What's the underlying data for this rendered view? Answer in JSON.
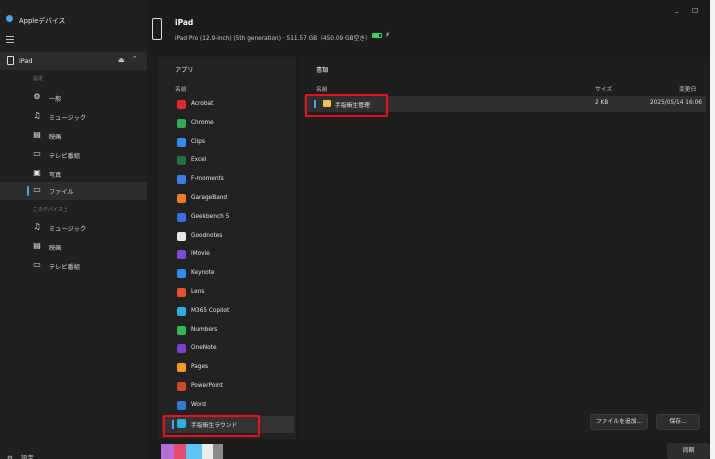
{
  "app": {
    "title": "Appleデバイス"
  },
  "sidebar": {
    "device_label": "iPad",
    "section_settings": "設定",
    "section_on_device": "このデバイス上",
    "items": [
      {
        "label": "一般",
        "icon": "gear-icon"
      },
      {
        "label": "ミュージック",
        "icon": "music-note-icon"
      },
      {
        "label": "映画",
        "icon": "film-icon"
      },
      {
        "label": "テレビ番組",
        "icon": "tv-icon"
      },
      {
        "label": "写真",
        "icon": "photo-icon"
      },
      {
        "label": "ファイル",
        "icon": "folder-icon"
      }
    ],
    "device_items": [
      {
        "label": "ミュージック",
        "icon": "music-note-icon"
      },
      {
        "label": "映画",
        "icon": "film-icon"
      },
      {
        "label": "テレビ番組",
        "icon": "tv-icon"
      }
    ],
    "settings_label": "設定"
  },
  "header": {
    "device_name": "iPad",
    "device_info": "iPad Pro (12.9-inch) (5th generation) · 511.57 GB（450.09 GB空き）"
  },
  "apps_panel": {
    "title": "アプリ",
    "column_name": "名前",
    "apps": [
      {
        "name": "Acrobat",
        "color": "#e5252a"
      },
      {
        "name": "Chrome",
        "color": "#34a853"
      },
      {
        "name": "Clips",
        "color": "#2f8cf0"
      },
      {
        "name": "Excel",
        "color": "#1f7244"
      },
      {
        "name": "F-moments",
        "color": "#3b7de8"
      },
      {
        "name": "GarageBand",
        "color": "#f07a20"
      },
      {
        "name": "Geekbench 5",
        "color": "#3a6ee8"
      },
      {
        "name": "Goodnotes",
        "color": "#e8e8e8"
      },
      {
        "name": "iMovie",
        "color": "#7a4cd9"
      },
      {
        "name": "Keynote",
        "color": "#2a8ff0"
      },
      {
        "name": "Lens",
        "color": "#e8502a"
      },
      {
        "name": "M365 Copilot",
        "color": "#2ab0e0"
      },
      {
        "name": "Numbers",
        "color": "#2dbb4e"
      },
      {
        "name": "OneNote",
        "color": "#7b3fc4"
      },
      {
        "name": "Pages",
        "color": "#f29c1f"
      },
      {
        "name": "PowerPoint",
        "color": "#d24726"
      },
      {
        "name": "Word",
        "color": "#2b7cd3"
      }
    ],
    "selected_app": {
      "name": "手指衛生ラウンド",
      "color": "#2ab0e0"
    }
  },
  "docs_panel": {
    "title": "書類",
    "column_name": "名前",
    "column_size": "サイズ",
    "column_modified": "変更日",
    "rows": [
      {
        "name": "手指衛生管理",
        "size": "2 KB",
        "modified": "2025/05/14 16:06"
      }
    ],
    "add_file_button": "ファイルを追加...",
    "save_button": "保存..."
  },
  "footer": {
    "sync_button": "同期",
    "storage_colors": [
      "#b36fd6",
      "#e64a6d",
      "#5ec3f2",
      "#ececec",
      "#8a8a8a"
    ]
  },
  "window_controls": {
    "minimize": "–",
    "maximize": "☐"
  }
}
